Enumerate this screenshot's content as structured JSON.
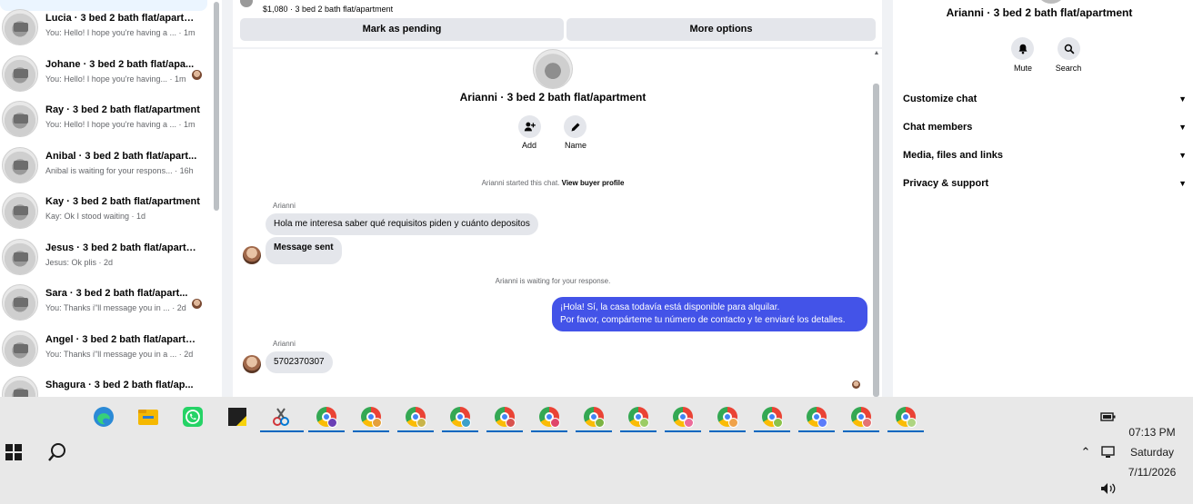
{
  "conversations": [
    {
      "title": "Lucia · 3 bed 2 bath flat/apartme...",
      "preview": "You: Hello! I hope you're having a ... · 1m"
    },
    {
      "title": "Johane · 3 bed 2 bath flat/apa...",
      "preview": "You: Hello! I hope you're having... · 1m"
    },
    {
      "title": "Ray · 3 bed 2 bath flat/apartment",
      "preview": "You: Hello! I hope you're having a ... · 1m"
    },
    {
      "title": "Anibal · 3 bed 2 bath flat/apart...",
      "preview": "Anibal is waiting for your respons... · 16h"
    },
    {
      "title": "Kay · 3 bed 2 bath flat/apartment",
      "preview": "Kay: Ok I stood waiting · 1d"
    },
    {
      "title": "Jesus · 3 bed 2 bath flat/apartme...",
      "preview": "Jesus: Ok plis · 2d"
    },
    {
      "title": "Sara · 3 bed 2 bath flat/apart...",
      "preview": "You: Thanks i\"ll message you in ... · 2d"
    },
    {
      "title": "Angel · 3 bed 2 bath flat/apartm...",
      "preview": "You: Thanks i\"ll message you in a ... · 2d"
    },
    {
      "title": "Shagura · 3 bed 2 bath flat/ap...",
      "preview": ""
    }
  ],
  "listing": {
    "line": "$1,080 · 3 bed 2 bath flat/apartment",
    "mark_pending": "Mark as pending",
    "more_options": "More options"
  },
  "chat": {
    "name": "Arianni · 3 bed 2 bath flat/apartment",
    "add_label": "Add",
    "name_label": "Name",
    "started_note": "Arianni started this chat.",
    "view_profile": "View buyer profile",
    "sender1": "Arianni",
    "msg1": "Hola me interesa saber qué requisitos piden y cuánto depositos",
    "msg2": "Message sent",
    "waiting_note": "Arianni is waiting for your response.",
    "out_line1": "¡Hola! Sí, la casa todavía está disponible para alquilar.",
    "out_line2": "Por favor, compárteme tu número de contacto y te enviaré los detalles.",
    "sender2": "Arianni",
    "msg3": "5702370307"
  },
  "right_panel": {
    "title": "Arianni · 3 bed 2 bath flat/apartment",
    "mute": "Mute",
    "search": "Search",
    "sections": [
      "Customize chat",
      "Chat members",
      "Media, files and links",
      "Privacy & support"
    ]
  },
  "taskbar": {
    "time": "07:13 PM",
    "day": "Saturday",
    "date": "7/11/2026"
  },
  "colors": {
    "outgoing_bubble": "#4353e8",
    "incoming_bubble": "#e4e6eb",
    "taskbar_accent": "#0067c0"
  }
}
